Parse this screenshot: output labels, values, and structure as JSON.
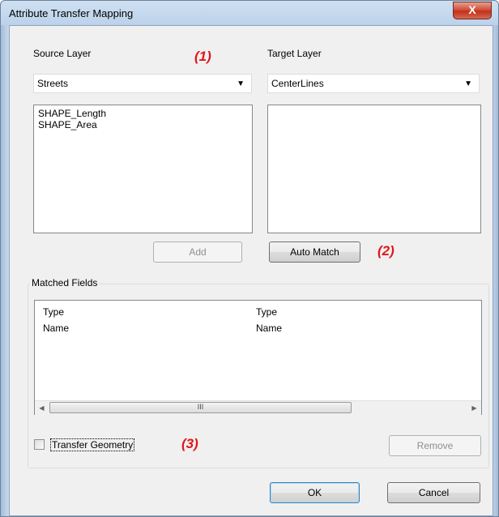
{
  "window": {
    "title": "Attribute Transfer Mapping",
    "close_label": "x"
  },
  "source": {
    "label": "Source Layer",
    "selected": "Streets",
    "fields": [
      "SHAPE_Length",
      "SHAPE_Area"
    ]
  },
  "target": {
    "label": "Target Layer",
    "selected": "CenterLines",
    "fields": []
  },
  "annotations": {
    "one": "(1)",
    "two": "(2)",
    "three": "(3)"
  },
  "buttons": {
    "add": "Add",
    "auto_match": "Auto Match",
    "remove": "Remove",
    "ok": "OK",
    "cancel": "Cancel"
  },
  "matched": {
    "title": "Matched Fields",
    "rows": [
      {
        "source": "Type",
        "target": "Type"
      },
      {
        "source": "Name",
        "target": "Name"
      }
    ],
    "scroll_thumb": "III"
  },
  "transfer_geometry": {
    "label": "Transfer Geometry",
    "checked": false
  },
  "icons": {
    "dropdown": "chevron-down-icon",
    "close": "close-icon"
  }
}
